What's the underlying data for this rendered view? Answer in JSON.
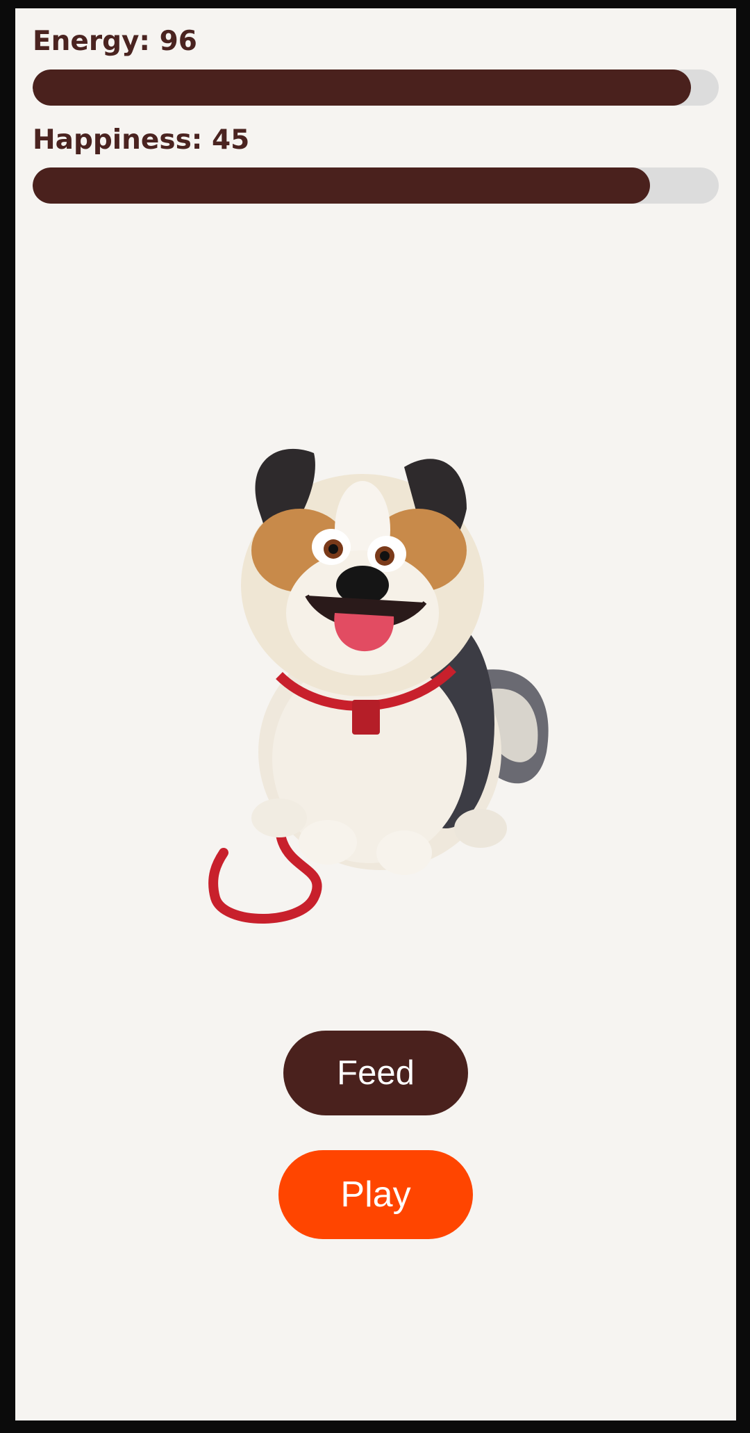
{
  "stats": {
    "energy": {
      "label": "Energy: 96",
      "value": 96
    },
    "happiness": {
      "label": "Happiness: 45",
      "value": 90
    }
  },
  "pet": {
    "image_icon": "cartoon-dog-icon"
  },
  "buttons": {
    "feed_label": "Feed",
    "play_label": "Play"
  },
  "colors": {
    "bar_fill": "#4a211d",
    "bar_track": "#dcdcdc",
    "text": "#4a2320",
    "feed_bg": "#4a211d",
    "play_bg": "#ff4500",
    "background": "#f6f4f1",
    "frame": "#0b0b0b"
  }
}
